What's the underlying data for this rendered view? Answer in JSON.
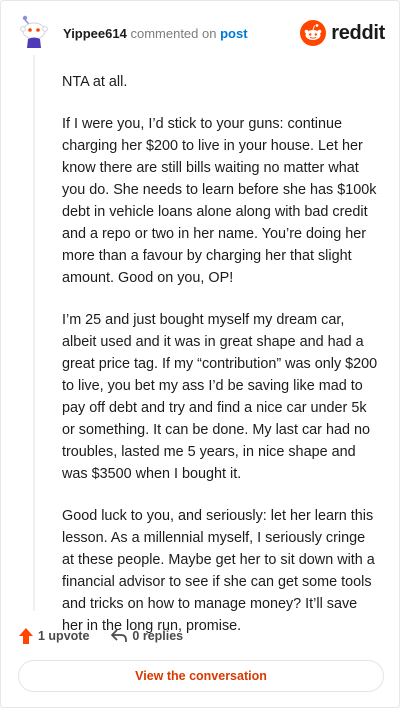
{
  "header": {
    "username": "Yippee614",
    "action_text": "commented on",
    "post_link": "post",
    "logo_text": "reddit",
    "brand_color": "#ff4500",
    "avatar_icon": "snoo-avatar-icon",
    "logo_icon": "reddit-alien-icon"
  },
  "comment": {
    "paragraphs": [
      "NTA at all.",
      "If I were you, I’d stick to your guns: continue charging her $200 to live in your house. Let her know there are still bills waiting no matter what you do. She needs to learn before she has $100k debt in vehicle loans alone along with bad credit and a repo or two in her name. You’re doing her more than a favour by charging her that slight amount. Good on you, OP!",
      "I’m 25 and just bought myself my dream car, albeit used and it was in great shape and had a great price tag. If my “contribution” was only $200 to live, you bet my ass I’d be saving like mad to pay off debt and try and find a nice car under 5k or something. It can be done. My last car had no troubles, lasted me 5 years, in nice shape and was $3500 when I bought it.",
      "Good luck to you, and seriously: let her learn this lesson. As a millennial myself, I seriously cringe at these people. Maybe get her to sit down with a financial advisor to see if she can get some tools and tricks on how to manage money? It’ll save her in the long run, promise."
    ]
  },
  "actions": {
    "upvote_label": "1 upvote",
    "upvote_icon": "upvote-arrow-icon",
    "replies_label": "0 replies",
    "replies_icon": "reply-arrow-icon"
  },
  "footer": {
    "view_button_label": "View the conversation",
    "accent_color": "#d93a00"
  }
}
